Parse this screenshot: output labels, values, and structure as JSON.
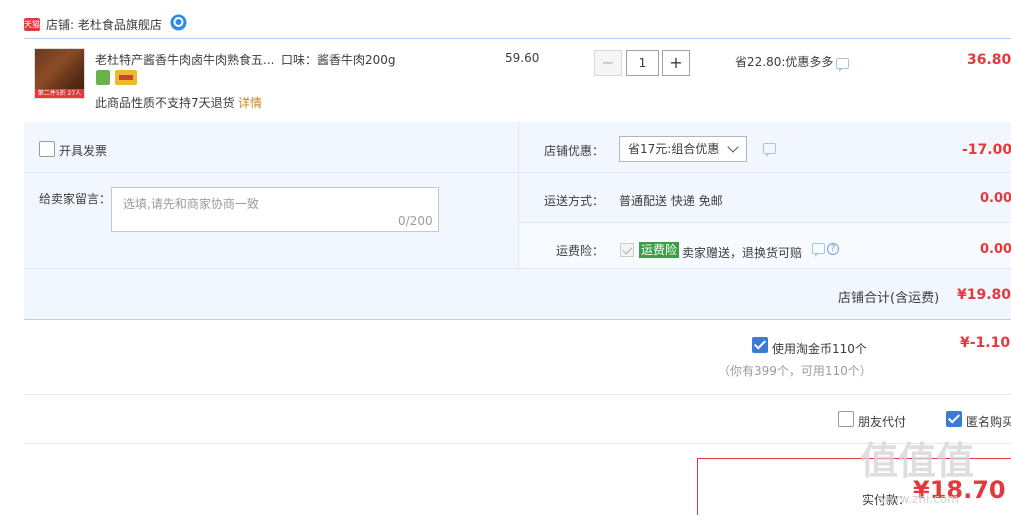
{
  "shop": {
    "badge": "天猫",
    "name": "店铺: 老杜食品旗舰店"
  },
  "item": {
    "thumb_tag": "第二件5折  27人",
    "title": "老杜特产酱香牛肉卤牛肉熟食五...",
    "sku": "口味：酱香牛肉200g",
    "no_return": "此商品性质不支持7天退货",
    "detail_link": "详情",
    "price": "59.60",
    "qty_minus": "−",
    "quantity": "1",
    "qty_plus": "+",
    "saving": "省22.80:优惠多多",
    "total": "36.80"
  },
  "invoice": {
    "label": "开具发票",
    "checked": false
  },
  "note": {
    "label": "给卖家留言：",
    "placeholder": "选填,请先和商家协商一致",
    "count": "0/200"
  },
  "shop_discount": {
    "label": "店铺优惠：",
    "selected": "省17元:组合优惠",
    "amount": "-17.00"
  },
  "shipping": {
    "label": "运送方式：",
    "value": "普通配送 快递 免邮",
    "amount": "0.00"
  },
  "insurance": {
    "label": "运费险：",
    "badge": "运费险",
    "text": "卖家赠送，退换货可赔",
    "help": "?",
    "amount": "0.00"
  },
  "shop_total": {
    "label": "店铺合计(含运费)",
    "amount": "¥19.80"
  },
  "coins": {
    "label": "使用淘金币110个",
    "sub": "（你有399个，可用110个）",
    "amount": "¥-1.10",
    "checked": true
  },
  "options": {
    "friend_pay": "朋友代付",
    "anonymous": "匿名购买"
  },
  "payment": {
    "label": "实付款：",
    "amount": "¥18.70"
  },
  "watermark": {
    "main": "值值值",
    "sub": "www.zhi.com"
  },
  "colors": {
    "price_red": "#e4393c",
    "panel_blue": "#f2f7ff",
    "checkbox_blue": "#3b7bd4"
  }
}
